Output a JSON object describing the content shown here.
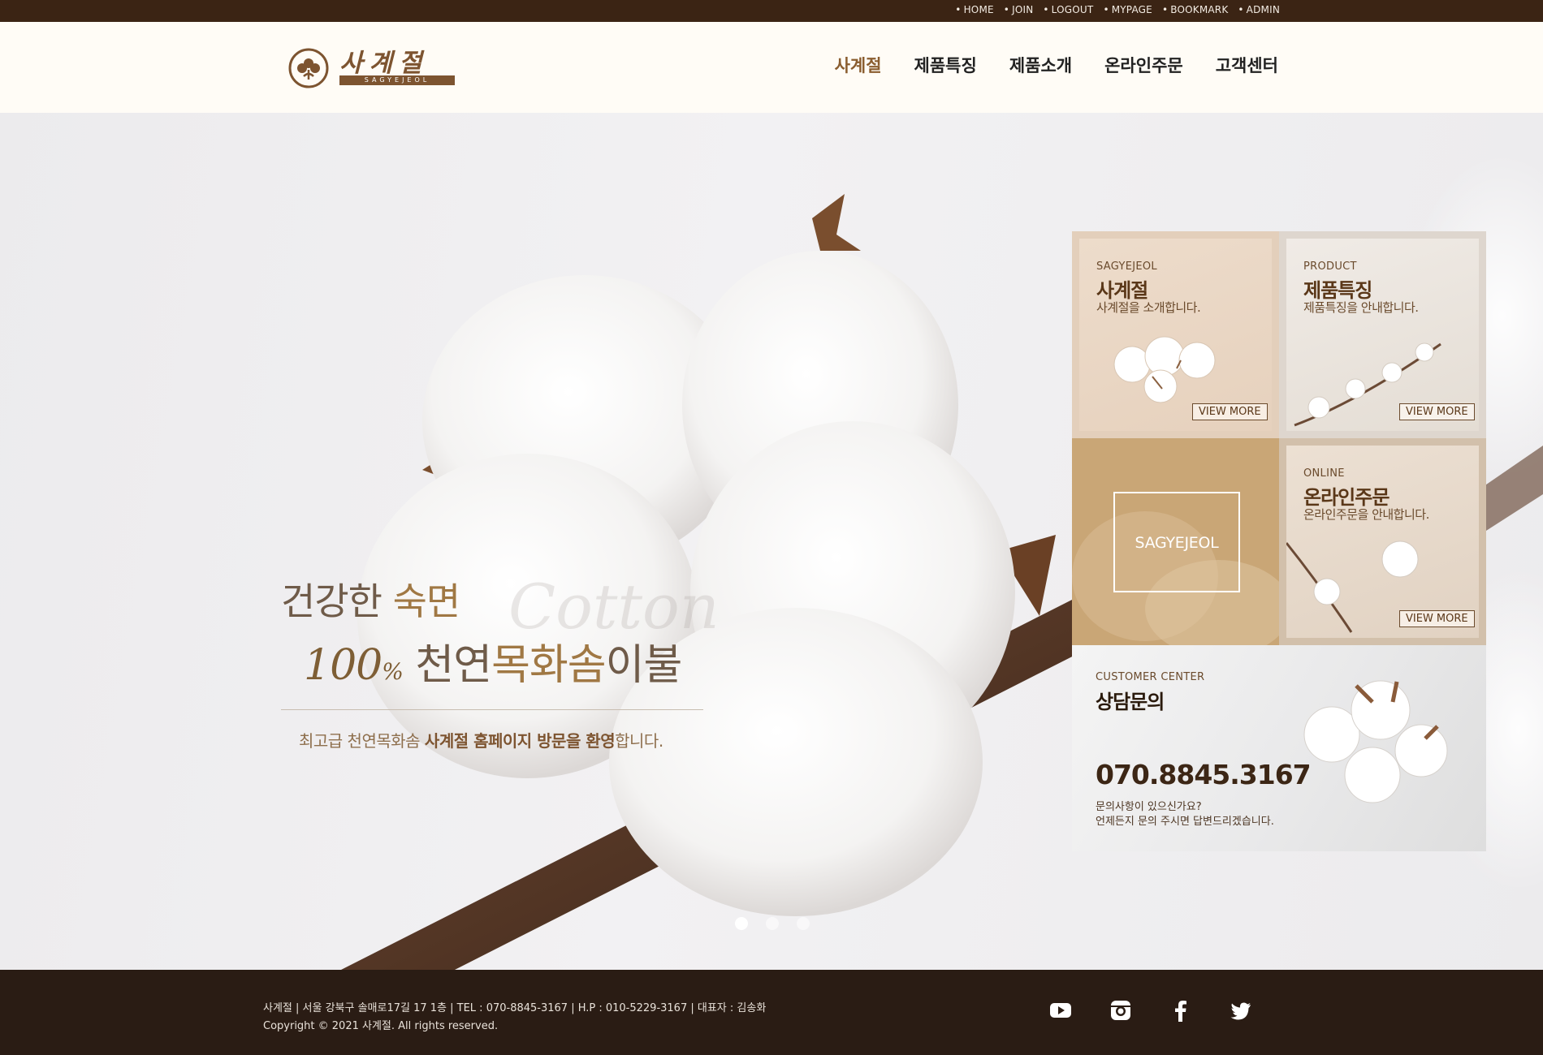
{
  "topbar": {
    "links": [
      "HOME",
      "JOIN",
      "LOGOUT",
      "MYPAGE",
      "BOOKMARK",
      "ADMIN"
    ]
  },
  "header": {
    "logo_text": "사계절",
    "logo_sub": "SAGYEJEOL",
    "nav": [
      "사계절",
      "제품특징",
      "제품소개",
      "온라인주문",
      "고객센터"
    ],
    "active_nav": 0
  },
  "hero": {
    "line1_a": "건강한 ",
    "line1_b": "숙면",
    "watermark": "Cotton",
    "line2_num": "100",
    "line2_pct": "%",
    "line2_a": " 천연",
    "line2_b": "목화솜",
    "line2_c": "이불",
    "sub_a": "최고급 천연목화솜 ",
    "sub_b": "사계절 홈페이지 방문을 환영",
    "sub_c": "합니다.",
    "slides": 3,
    "active_slide": 0
  },
  "boxes": {
    "box1": {
      "en": "SAGYEJEOL",
      "ko": "사계절",
      "desc": "사계절을 소개합니다.",
      "button": "VIEW MORE"
    },
    "box2": {
      "en": "PRODUCT",
      "ko": "제품특징",
      "desc": "제품특징을 안내합니다.",
      "button": "VIEW MORE"
    },
    "box3": {
      "label": "SAGYEJEOL"
    },
    "box4": {
      "en": "ONLINE",
      "ko": "온라인주문",
      "desc": "온라인주문을 안내합니다.",
      "button": "VIEW MORE"
    },
    "box5": {
      "en": "CUSTOMER CENTER",
      "ko": "상담문의",
      "phone": "070.8845.3167",
      "note1": "문의사항이 있으신가요?",
      "note2": "언제든지 문의 주시면 답변드리겠습니다."
    }
  },
  "footer": {
    "info": "사계절 | 서울 강북구 솔매로17길 17 1층 | TEL : 070-8845-3167 | H.P : 010-5229-3167 | 대표자 : 김송화",
    "copyright": "Copyright © 2021 사계절. All rights reserved.",
    "sns": [
      "youtube-icon",
      "instagram-icon",
      "facebook-icon",
      "twitter-icon"
    ]
  },
  "colors": {
    "topbar": "#3b2414",
    "header_bg": "#fffcf6",
    "accent": "#8a5d2f",
    "footer": "#2a1c14"
  }
}
